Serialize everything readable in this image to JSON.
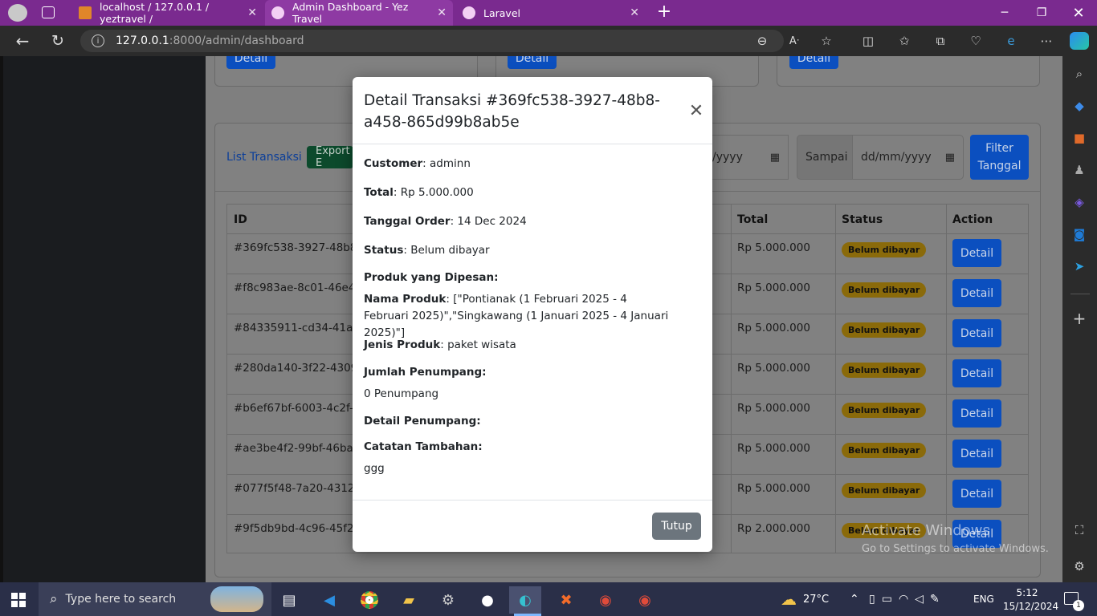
{
  "browser": {
    "tabs": [
      {
        "label": "localhost / 127.0.0.1 / yeztravel /",
        "active": false
      },
      {
        "label": "Admin Dashboard - Yez Travel",
        "active": true
      },
      {
        "label": "Laravel",
        "active": false
      }
    ],
    "url_host": "127.0.0.1",
    "url_path": ":8000/admin/dashboard"
  },
  "dashboard": {
    "detail_label": "Detail",
    "list_title": "List Transaksi",
    "export_label": "Export E",
    "date_from_placeholder": "/yyyy",
    "sampai_label": "Sampai",
    "date_to_placeholder": "dd/mm/yyyy",
    "filter_label_1": "Filter",
    "filter_label_2": "Tanggal",
    "table": {
      "headers": {
        "id": "ID",
        "total": "Total",
        "status": "Status",
        "action": "Action"
      },
      "rows": [
        {
          "id": "#369fc538-3927-48b8-a",
          "total": "Rp 5.000.000",
          "status": "Belum dibayar"
        },
        {
          "id": "#f8c983ae-8c01-46e4-a",
          "total": "Rp 5.000.000",
          "status": "Belum dibayar"
        },
        {
          "id": "#84335911-cd34-41a2-",
          "total": "Rp 5.000.000",
          "status": "Belum dibayar"
        },
        {
          "id": "#280da140-3f22-4309-9",
          "total": "Rp 5.000.000",
          "status": "Belum dibayar"
        },
        {
          "id": "#b6ef67bf-6003-4c2f-a",
          "total": "Rp 5.000.000",
          "status": "Belum dibayar"
        },
        {
          "id": "#ae3be4f2-99bf-46ba-b",
          "total": "Rp 5.000.000",
          "status": "Belum dibayar"
        },
        {
          "id": "#077f5f48-7a20-4312-8",
          "total": "Rp 5.000.000",
          "status": "Belum dibayar"
        },
        {
          "id": "#9f5db9bd-4c96-45f2-8",
          "total": "Rp 2.000.000",
          "status": "Belum dibayar"
        }
      ]
    }
  },
  "modal": {
    "title": "Detail Transaksi #369fc538-3927-48b8-a458-865d99b8ab5e",
    "customer_label": "Customer",
    "customer_value": "adminn",
    "total_label": "Total",
    "total_value": "Rp 5.000.000",
    "tanggal_label": "Tanggal Order",
    "tanggal_value": "14 Dec 2024",
    "status_label": "Status",
    "status_value": "Belum dibayar",
    "produk_heading": "Produk yang Dipesan:",
    "nama_produk_label": "Nama Produk",
    "nama_produk_value": "[\"Pontianak (1 Februari 2025 - 4 Februari 2025)\",\"Singkawang (1 Januari 2025 - 4 Januari 2025)\"]",
    "jenis_label": "Jenis Produk",
    "jenis_value": "paket wisata",
    "jumlah_heading": "Jumlah Penumpang:",
    "jumlah_value": "0 Penumpang",
    "detail_heading": "Detail Penumpang:",
    "catatan_heading": "Catatan Tambahan:",
    "catatan_value": "ggg",
    "close_label": "Tutup"
  },
  "watermark": {
    "line1": "Activate Windows",
    "line2": "Go to Settings to activate Windows."
  },
  "taskbar": {
    "search_placeholder": "Type here to search",
    "weather": "27°C",
    "lang": "ENG",
    "time": "5:12",
    "date": "15/12/2024",
    "notif_count": "1"
  }
}
